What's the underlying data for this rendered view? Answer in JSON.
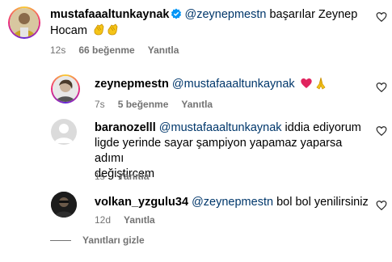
{
  "comments": [
    {
      "username": "mustafaaaltunkaynak",
      "verified": true,
      "mention": "@zeynepmestn",
      "text_line1": " başarılar Zeynep",
      "text_line2": "Hocam",
      "emojis": [
        "clapping-hands",
        "clapping-hands"
      ],
      "time": "12s",
      "likes": "66 beğenme",
      "reply": "Yanıtla"
    },
    {
      "username": "zeynepmestn",
      "mention": "@mustafaaaltunkaynak",
      "emojis": [
        "red-heart",
        "folded-hands"
      ],
      "time": "7s",
      "likes": "5 beğenme",
      "reply": "Yanıtla"
    },
    {
      "username": "baranozelll",
      "mention": "@mustafaaaltunkaynak",
      "text_line1": " iddia ediyorum",
      "text_line2": "ligde yerinde sayar şampiyon yapamaz yaparsa adımı",
      "text_line3": "değiştircem",
      "time": "1s",
      "reply": "Yanıtla"
    },
    {
      "username": "volkan_yzgulu34",
      "mention": "@zeynepmestn",
      "text_line1": " bol bol yenilirsiniz",
      "time": "12d",
      "reply": "Yanıtla"
    }
  ],
  "hide_replies": "Yanıtları gizle",
  "colors": {
    "mention": "#00376b",
    "meta": "#737373",
    "verified": "#0095f6",
    "heart": "#ed4956"
  }
}
